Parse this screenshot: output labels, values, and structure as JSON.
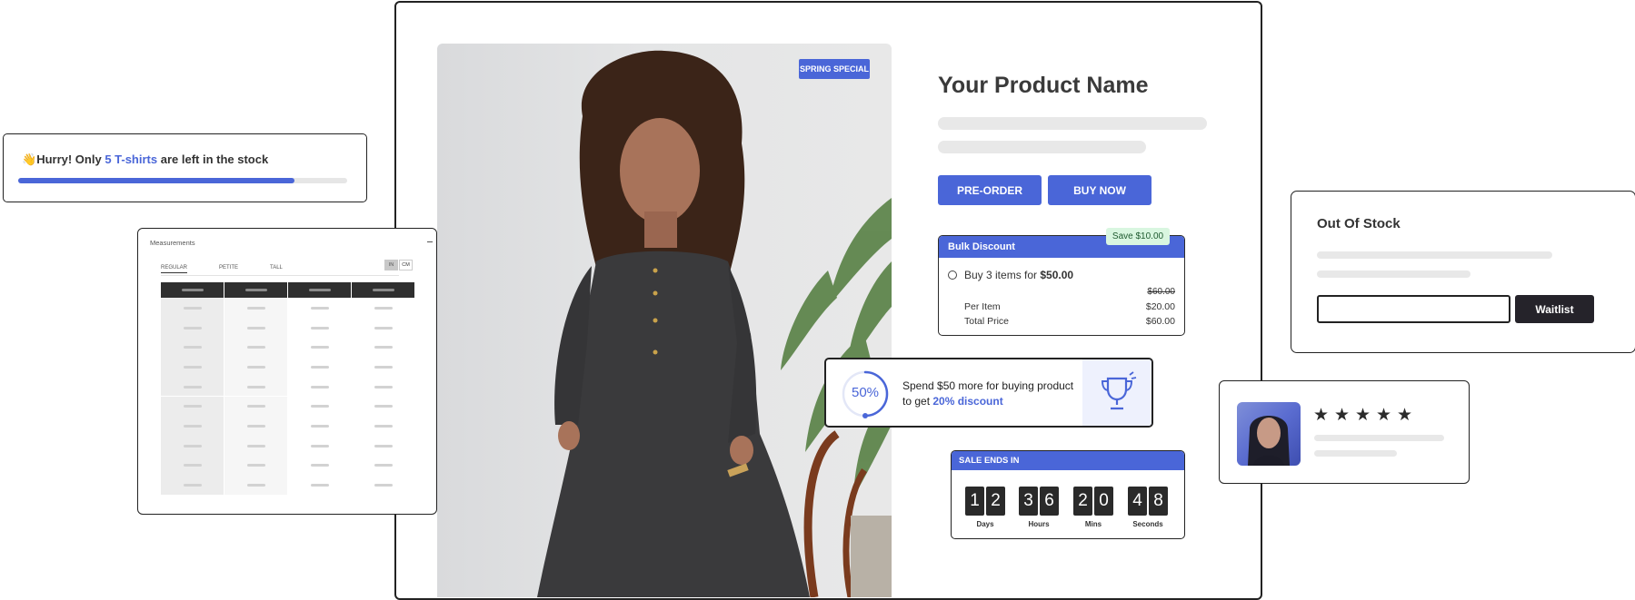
{
  "product": {
    "badge": "SPRING SPECIAL",
    "title": "Your Product Name",
    "preorder_label": "PRE-ORDER",
    "buy_label": "BUY NOW"
  },
  "bulk": {
    "header": "Bulk Discount",
    "save": "Save $10.00",
    "option_prefix": "Buy 3 items for ",
    "option_price": "$50.00",
    "old_price": "$60.00",
    "per_item_label": "Per Item",
    "per_item_value": "$20.00",
    "total_label": "Total Price",
    "total_value": "$60.00"
  },
  "spend": {
    "progress_label": "50%",
    "progress_fraction": 0.5,
    "line1": "Spend $50 more for buying product",
    "line2_prefix": "to get ",
    "line2_highlight": "20% discount"
  },
  "countdown": {
    "header": "SALE ENDS IN",
    "units": [
      {
        "digits": [
          "1",
          "2"
        ],
        "label": "Days"
      },
      {
        "digits": [
          "3",
          "6"
        ],
        "label": "Hours"
      },
      {
        "digits": [
          "2",
          "0"
        ],
        "label": "Mins"
      },
      {
        "digits": [
          "4",
          "8"
        ],
        "label": "Seconds"
      }
    ]
  },
  "hurry": {
    "emoji": "👋",
    "prefix": "Hurry! Only ",
    "highlight": "5 T-shirts",
    "suffix": " are left in the stock",
    "progress_fraction": 0.84
  },
  "measurements": {
    "title": "Measurements",
    "tabs": [
      "REGULAR",
      "PETITE",
      "TALL"
    ],
    "units": [
      "IN",
      "CM"
    ],
    "rows": 10,
    "cols": 4
  },
  "out_of_stock": {
    "title": "Out Of Stock",
    "input_value": "",
    "waitlist_label": "Waitlist"
  },
  "review": {
    "stars": 5
  },
  "colors": {
    "accent": "#4a66d8",
    "dark": "#25232a",
    "save_bg": "#d9f6e0"
  }
}
